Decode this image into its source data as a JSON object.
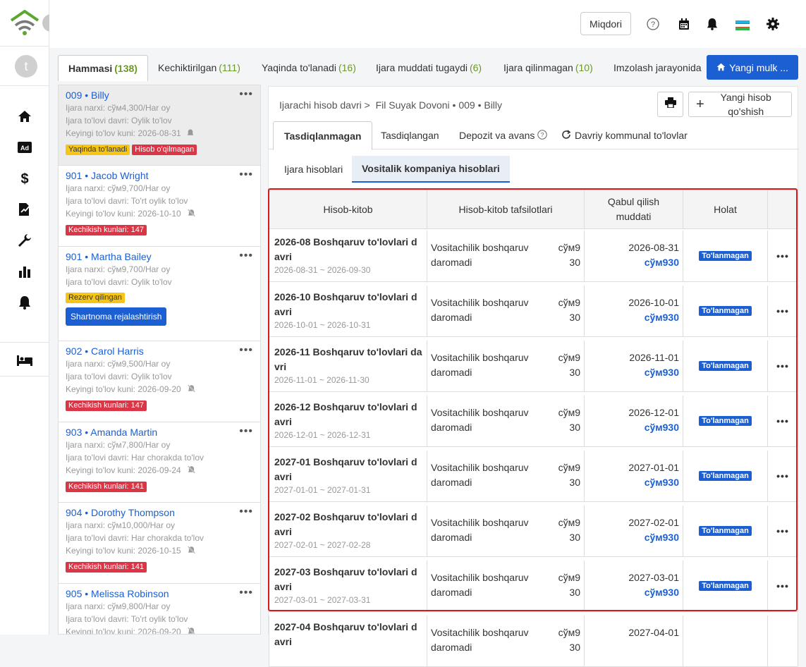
{
  "topbar": {
    "qty_label": "Miqdori"
  },
  "sidebar": {
    "avatar_letter": "t"
  },
  "tabs": [
    {
      "label": "Hammasi",
      "count": "(138)"
    },
    {
      "label": "Kechiktirilgan",
      "count": "(111)"
    },
    {
      "label": "Yaqinda to'lanadi",
      "count": "(16)"
    },
    {
      "label": "Ijara muddati tugaydi",
      "count": "(6)"
    },
    {
      "label": "Ijara qilinmagan",
      "count": "(10)"
    },
    {
      "label": "Imzolash jarayonida",
      "count": ""
    }
  ],
  "new_property_label": "Yangi mulk ...",
  "tenants": [
    {
      "unit": "009",
      "name": "Billy",
      "price": "Ijara narxi: сўм4,300/Har oy",
      "period": "Ijara to'lovi davri: Oylik to'lov",
      "next": "Keyingi to'lov kuni:  2026-08-31",
      "badges": [
        "Yaqinda to'lanadi",
        "Hisob o'qilmagan"
      ]
    },
    {
      "unit": "901",
      "name": "Jacob Wright",
      "price": "Ijara narxi: сўм9,700/Har oy",
      "period": "Ijara to'lovi davri: To'rt oylik to'lov",
      "next": "Keyingi to'lov kuni:  2026-10-10",
      "badges": [
        "Kechikish kunlari: 147"
      ]
    },
    {
      "unit": "901",
      "name": "Martha Bailey",
      "price": "Ijara narxi: сўм9,700/Har oy",
      "period": "Ijara to'lovi davri: Oylik to'lov",
      "badges": [
        "Rezerv qilingan"
      ],
      "button": "Shartnoma rejalashtirish"
    },
    {
      "unit": "902",
      "name": "Carol Harris",
      "price": "Ijara narxi: сўм9,500/Har oy",
      "period": "Ijara to'lovi davri: Oylik to'lov",
      "next": "Keyingi to'lov kuni:  2026-09-20",
      "badges": [
        "Kechikish kunlari: 147"
      ]
    },
    {
      "unit": "903",
      "name": "Amanda Martin",
      "price": "Ijara narxi: сўм7,800/Har oy",
      "period": "Ijara to'lovi davri: Har chorakda to'lov",
      "next": "Keyingi to'lov kuni:  2026-09-24",
      "badges": [
        "Kechikish kunlari: 141"
      ]
    },
    {
      "unit": "904",
      "name": "Dorothy Thompson",
      "price": "Ijara narxi: сўм10,000/Har oy",
      "period": "Ijara to'lovi davri: Har chorakda to'lov",
      "next": "Keyingi to'lov kuni:  2026-10-15",
      "badges": [
        "Kechikish kunlari: 141"
      ]
    },
    {
      "unit": "905",
      "name": "Melissa Robinson",
      "price": "Ijara narxi: сўм9,800/Har oy",
      "period": "Ijara to'lovi davri: To'rt oylik to'lov",
      "next": "Keyingi to'lov kuni:  2026-09-20",
      "badges": []
    }
  ],
  "breadcrumb": {
    "root": "Ijarachi hisob davri",
    "sep": ">",
    "current": "Fil Suyak Dovoni • 009 • Billy"
  },
  "add_bill_label": "Yangi hisob qo'shish",
  "section_tabs": [
    "Tasdiqlanmagan",
    "Tasdiqlangan",
    "Depozit va avans",
    "Davriy kommunal to'lovlar"
  ],
  "sub_tabs": [
    "Ijara hisoblari",
    "Vositalik kompaniya hisoblari"
  ],
  "table": {
    "headers": [
      "Hisob-kitob",
      "Hisob-kitob tafsilotlari",
      "Qabul qilish muddati",
      "Holat"
    ],
    "rows": [
      {
        "title": "2026-08 Boshqaruv to'lovlari davri",
        "range": "2026-08-31 ~ 2026-09-30",
        "detail": "Vositachilik boshqaruv daromadi",
        "amount": "сўм930",
        "due": "2026-08-31",
        "due_amount": "сўм930",
        "status": "To'lanmagan"
      },
      {
        "title": "2026-10 Boshqaruv to'lovlari davri",
        "range": "2026-10-01 ~ 2026-10-31",
        "detail": "Vositachilik boshqaruv daromadi",
        "amount": "сўм930",
        "due": "2026-10-01",
        "due_amount": "сўм930",
        "status": "To'lanmagan"
      },
      {
        "title": "2026-11 Boshqaruv to'lovlari davri",
        "range": "2026-11-01 ~ 2026-11-30",
        "detail": "Vositachilik boshqaruv daromadi",
        "amount": "сўм930",
        "due": "2026-11-01",
        "due_amount": "сўм930",
        "status": "To'lanmagan"
      },
      {
        "title": "2026-12 Boshqaruv to'lovlari davri",
        "range": "2026-12-01 ~ 2026-12-31",
        "detail": "Vositachilik boshqaruv daromadi",
        "amount": "сўм930",
        "due": "2026-12-01",
        "due_amount": "сўм930",
        "status": "To'lanmagan"
      },
      {
        "title": "2027-01 Boshqaruv to'lovlari davri",
        "range": "2027-01-01 ~ 2027-01-31",
        "detail": "Vositachilik boshqaruv daromadi",
        "amount": "сўм930",
        "due": "2027-01-01",
        "due_amount": "сўм930",
        "status": "To'lanmagan"
      },
      {
        "title": "2027-02 Boshqaruv to'lovlari davri",
        "range": "2027-02-01 ~ 2027-02-28",
        "detail": "Vositachilik boshqaruv daromadi",
        "amount": "сўм930",
        "due": "2027-02-01",
        "due_amount": "сўм930",
        "status": "To'lanmagan"
      },
      {
        "title": "2027-03 Boshqaruv to'lovlari davri",
        "range": "2027-03-01 ~ 2027-03-31",
        "detail": "Vositachilik boshqaruv daromadi",
        "amount": "сўм930",
        "due": "2027-03-01",
        "due_amount": "сўм930",
        "status": "To'lanmagan"
      },
      {
        "title": "2027-04 Boshqaruv to'lovlari davri",
        "range": "",
        "detail": "Vositachilik boshqaruv daromadi",
        "amount": "сўм930",
        "due": "2027-04-01",
        "due_amount": "",
        "status": ""
      }
    ]
  },
  "colors": {
    "accent": "#1b5fd3",
    "count_green": "#6a9a1f",
    "danger": "#dc3545",
    "warning": "#f5c518",
    "highlight": "#d7191c"
  },
  "icons": [
    "wifi-home-logo",
    "chevron-right-icon",
    "home-icon",
    "ad-icon",
    "dollar-icon",
    "contract-icon",
    "wrench-icon",
    "chart-icon",
    "bell-icon",
    "bed-icon",
    "help-icon",
    "calendar-icon",
    "bell-icon",
    "flag-icon",
    "gear-icon",
    "print-icon",
    "refresh-icon"
  ]
}
